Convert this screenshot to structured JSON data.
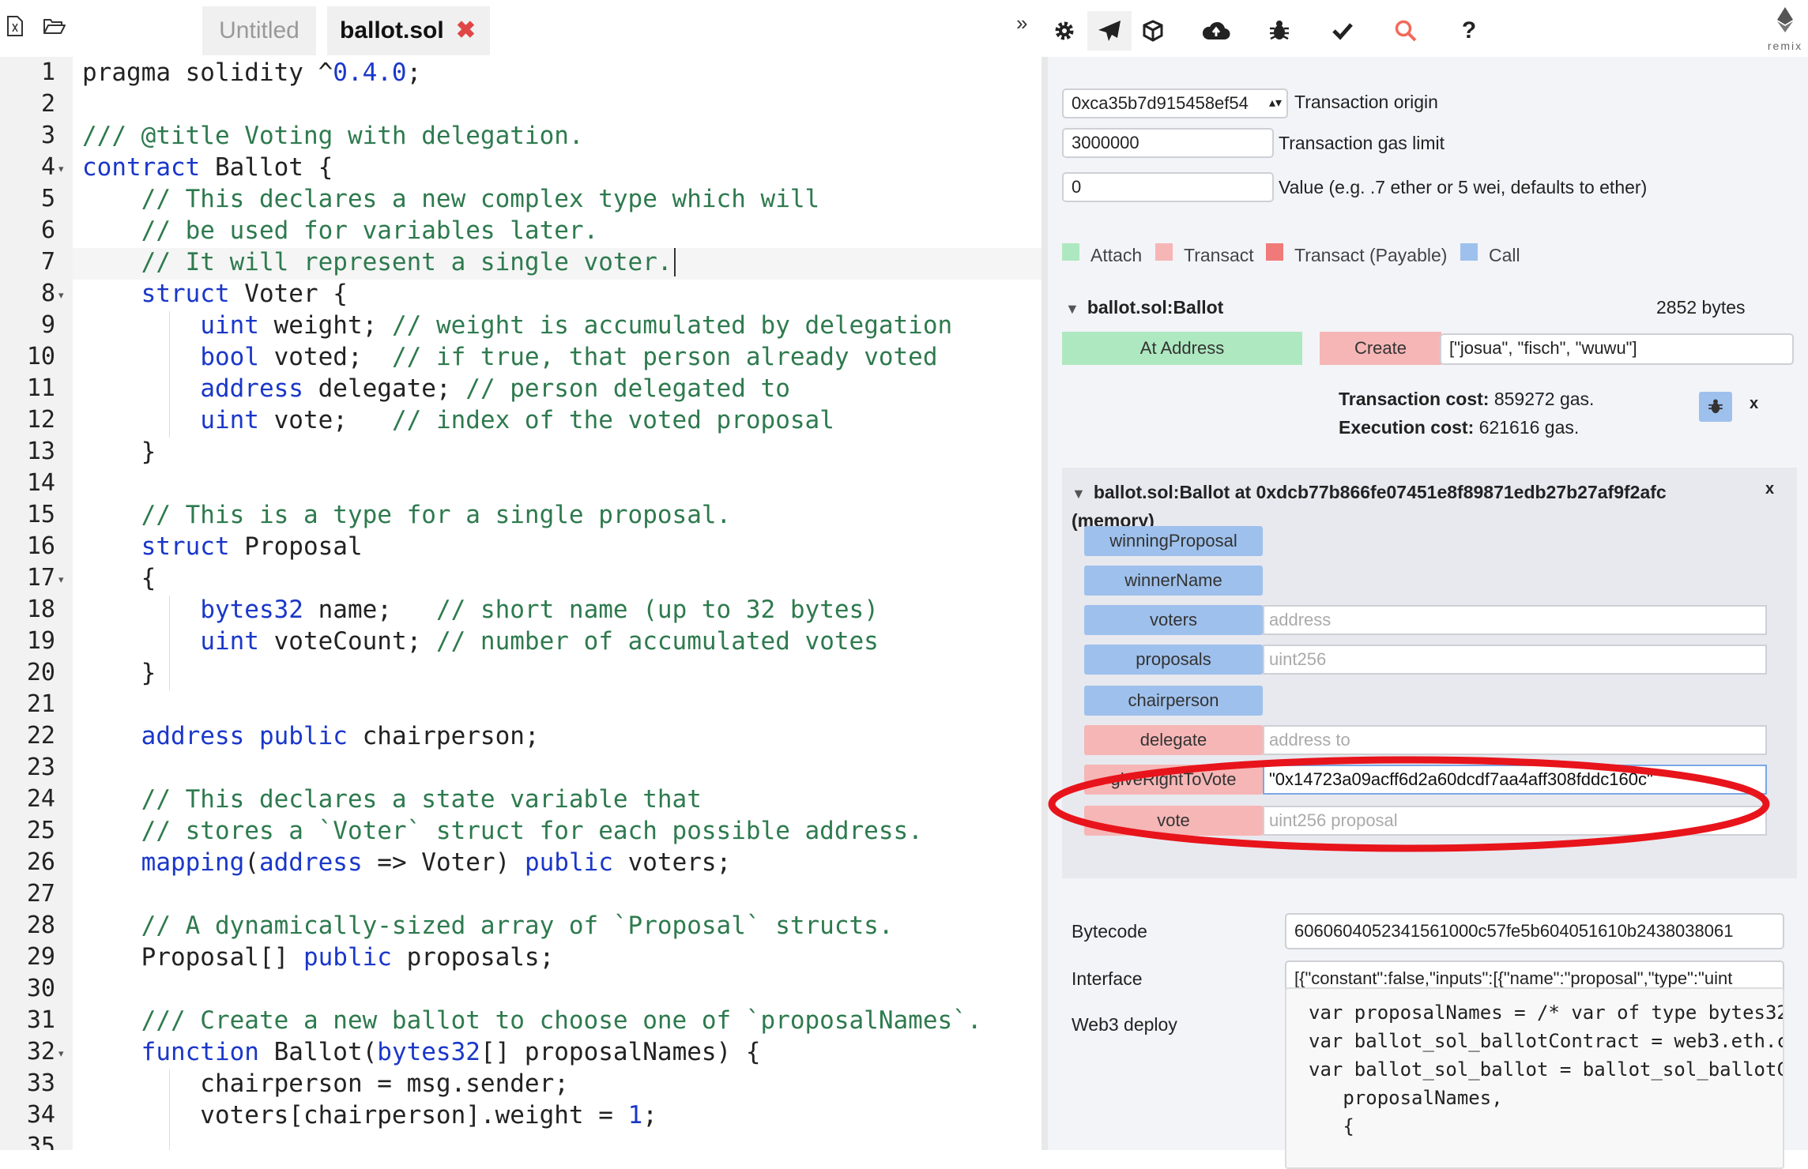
{
  "tabs": {
    "untitled": "Untitled",
    "ballot": "ballot.sol",
    "close_glyph": "✖"
  },
  "toolbar": {
    "collapse": "»",
    "icons": [
      "settings-icon",
      "run-icon",
      "compile-icon",
      "publish-icon",
      "debugger-icon",
      "analysis-icon",
      "search-icon",
      "help-icon"
    ],
    "help": "?",
    "logo_text": "remix"
  },
  "editor": {
    "line_numbers": [
      "1",
      "2",
      "3",
      "4",
      "5",
      "6",
      "7",
      "8",
      "9",
      "10",
      "11",
      "12",
      "13",
      "14",
      "15",
      "16",
      "17",
      "18",
      "19",
      "20",
      "21",
      "22",
      "23",
      "24",
      "25",
      "26",
      "27",
      "28",
      "29",
      "30",
      "31",
      "32",
      "33",
      "34",
      "35"
    ],
    "fold_lines": [
      4,
      8,
      17,
      32
    ],
    "active_line": 7,
    "lines": [
      [
        [
          "",
          "pragma solidity ^"
        ],
        [
          "num",
          "0.4.0"
        ],
        [
          "",
          ";"
        ]
      ],
      [],
      [
        [
          "cm",
          "/// @title Voting with delegation."
        ]
      ],
      [
        [
          "kw",
          "contract"
        ],
        [
          "",
          " Ballot {"
        ]
      ],
      [
        [
          "cm",
          "    // This declares a new complex type which will"
        ]
      ],
      [
        [
          "cm",
          "    // be used for variables later."
        ]
      ],
      [
        [
          "cm",
          "    // It will represent a single voter."
        ]
      ],
      [
        [
          "",
          "    "
        ],
        [
          "kw",
          "struct"
        ],
        [
          "",
          " Voter {"
        ]
      ],
      [
        [
          "",
          "        "
        ],
        [
          "kw",
          "uint"
        ],
        [
          "",
          " weight; "
        ],
        [
          "cm",
          "// weight is accumulated by delegation"
        ]
      ],
      [
        [
          "",
          "        "
        ],
        [
          "kw",
          "bool"
        ],
        [
          "",
          " voted;  "
        ],
        [
          "cm",
          "// if true, that person already voted"
        ]
      ],
      [
        [
          "",
          "        "
        ],
        [
          "kw",
          "address"
        ],
        [
          "",
          " delegate; "
        ],
        [
          "cm",
          "// person delegated to"
        ]
      ],
      [
        [
          "",
          "        "
        ],
        [
          "kw",
          "uint"
        ],
        [
          "",
          " vote;   "
        ],
        [
          "cm",
          "// index of the voted proposal"
        ]
      ],
      [
        [
          "",
          "    }"
        ]
      ],
      [],
      [
        [
          "cm",
          "    // This is a type for a single proposal."
        ]
      ],
      [
        [
          "",
          "    "
        ],
        [
          "kw",
          "struct"
        ],
        [
          "",
          " Proposal"
        ]
      ],
      [
        [
          "",
          "    {"
        ]
      ],
      [
        [
          "",
          "        "
        ],
        [
          "kw",
          "bytes32"
        ],
        [
          "",
          " name;   "
        ],
        [
          "cm",
          "// short name (up to 32 bytes)"
        ]
      ],
      [
        [
          "",
          "        "
        ],
        [
          "kw",
          "uint"
        ],
        [
          "",
          " voteCount; "
        ],
        [
          "cm",
          "// number of accumulated votes"
        ]
      ],
      [
        [
          "",
          "    }"
        ]
      ],
      [],
      [
        [
          "",
          "    "
        ],
        [
          "kw",
          "address public"
        ],
        [
          "",
          " chairperson;"
        ]
      ],
      [],
      [
        [
          "cm",
          "    // This declares a state variable that"
        ]
      ],
      [
        [
          "cm",
          "    // stores a `Voter` struct for each possible address."
        ]
      ],
      [
        [
          "",
          "    "
        ],
        [
          "kw",
          "mapping"
        ],
        [
          "",
          "("
        ],
        [
          "kw",
          "address"
        ],
        [
          "",
          " => Voter) "
        ],
        [
          "kw",
          "public"
        ],
        [
          "",
          " voters;"
        ]
      ],
      [],
      [
        [
          "cm",
          "    // A dynamically-sized array of `Proposal` structs."
        ]
      ],
      [
        [
          "",
          "    Proposal[] "
        ],
        [
          "kw",
          "public"
        ],
        [
          "",
          " proposals;"
        ]
      ],
      [],
      [
        [
          "cm",
          "    /// Create a new ballot to choose one of `proposalNames`."
        ]
      ],
      [
        [
          "",
          "    "
        ],
        [
          "kw",
          "function"
        ],
        [
          "",
          " Ballot("
        ],
        [
          "kw",
          "bytes32"
        ],
        [
          "",
          "[] proposalNames) {"
        ]
      ],
      [
        [
          "",
          "        chairperson = msg.sender;"
        ]
      ],
      [
        [
          "",
          "        voters[chairperson].weight = "
        ],
        [
          "num",
          "1"
        ],
        [
          "",
          ";"
        ]
      ],
      []
    ]
  },
  "run_panel": {
    "origin_value": "0xca35b7d915458ef54",
    "origin_label": "Transaction origin",
    "gas_value": "3000000",
    "gas_label": "Transaction gas limit",
    "value_value": "0",
    "value_label": "Value (e.g. .7 ether or 5 wei, defaults to ether)",
    "legend": {
      "attach": "Attach",
      "transact": "Transact",
      "transact_payable": "Transact (Payable)",
      "call": "Call"
    },
    "contract_name": "ballot.sol:Ballot",
    "contract_size": "2852 bytes",
    "at_address": "At Address",
    "create": "Create",
    "create_args": "[\"josua\", \"fisch\", \"wuwu\"]",
    "tx_cost_label": "Transaction cost:",
    "tx_cost_value": " 859272 gas.",
    "exec_cost_label": "Execution cost:",
    "exec_cost_value": " 621616 gas.",
    "close_x": "x",
    "instance_title": "ballot.sol:Ballot at 0xdcb77b866fe07451e8f89871edb27b27af9f2afc",
    "instance_sub": "(memory)",
    "functions": {
      "winningProposal": "winningProposal",
      "winnerName": "winnerName",
      "voters": "voters",
      "voters_ph": "address",
      "proposals": "proposals",
      "proposals_ph": "uint256",
      "chairperson": "chairperson",
      "delegate": "delegate",
      "delegate_ph": "address to",
      "giveRightToVote": "giveRightToVote",
      "giveRightToVote_val": "\"0x14723a09acff6d2a60dcdf7aa4aff308fddc160c\"",
      "vote": "vote",
      "vote_ph": "uint256 proposal"
    },
    "bytecode_label": "Bytecode",
    "bytecode_value": "6060604052341561000c57fe5b604051610b2438038061",
    "interface_label": "Interface",
    "interface_value": "[{\"constant\":false,\"inputs\":[{\"name\":\"proposal\",\"type\":\"uint",
    "web3_label": "Web3 deploy",
    "web3_lines": [
      "var proposalNames = /* var of type bytes32",
      "var ballot_sol_ballotContract = web3.eth.c",
      "var ballot_sol_ballot = ballot_sol_ballotC",
      "   proposalNames,",
      "   {"
    ]
  },
  "colors": {
    "keyword": "#1a37c9",
    "comment": "#2e7a4e",
    "call_blue": "#9ec0ec",
    "transact_pink": "#f6b6b6",
    "payable_red": "#f07a7a",
    "attach_green": "#aee8c0",
    "highlight_red": "#e8141b"
  }
}
